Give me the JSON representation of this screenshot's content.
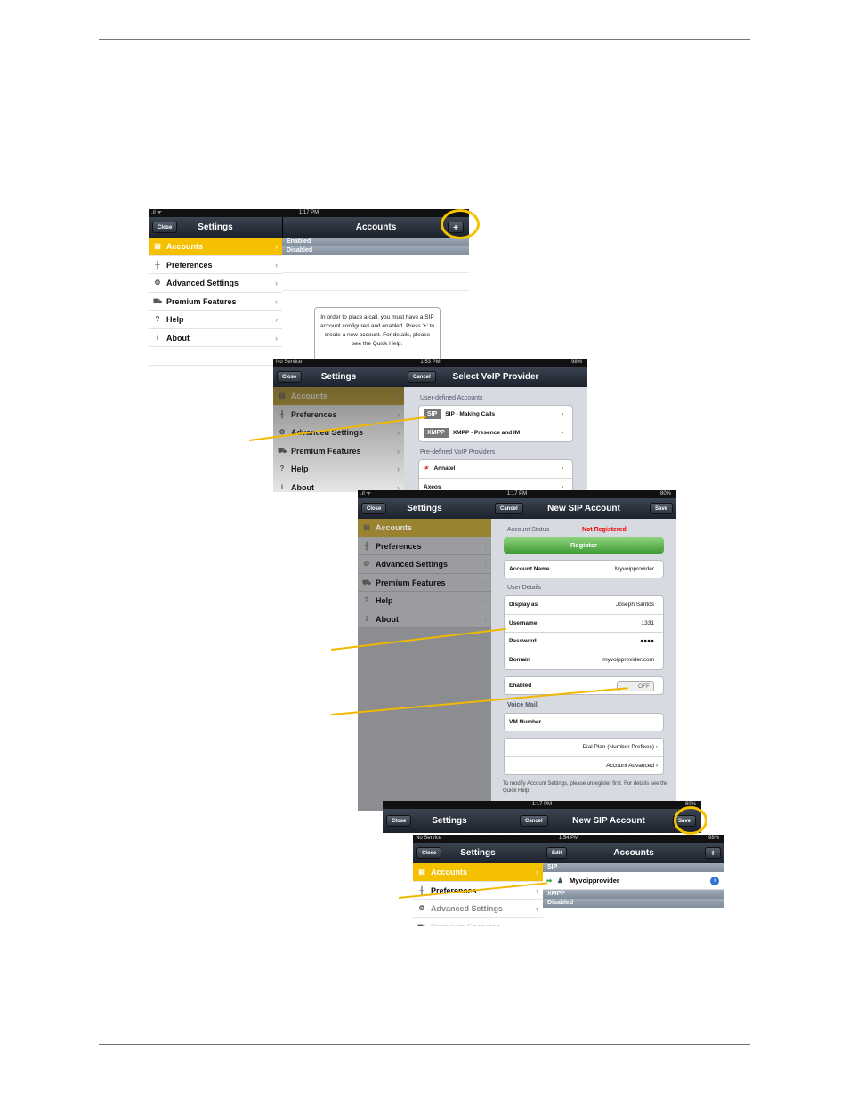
{
  "s1": {
    "time": "1:17 PM",
    "left_title": "Settings",
    "close": "Close",
    "right_title": "Accounts",
    "plus": "+",
    "menu": [
      {
        "label": "Accounts",
        "icon": "accounts-icon"
      },
      {
        "label": "Preferences",
        "icon": "preferences-icon"
      },
      {
        "label": "Advanced Settings",
        "icon": "gears-icon"
      },
      {
        "label": "Premium Features",
        "icon": "cart-icon"
      },
      {
        "label": "Help",
        "icon": "help-icon"
      },
      {
        "label": "About",
        "icon": "info-icon"
      }
    ],
    "enabled": "Enabled",
    "disabled": "Disabled",
    "hint": "In order to place a call, you must have a SIP account configured and enabled. Press '+' to create a new account. For details, please see the Quick Help."
  },
  "s2": {
    "carrier": "No Service",
    "time": "1:53 PM",
    "battery": "98%",
    "cancel": "Cancel",
    "title": "Select VoIP Provider",
    "left_title": "Settings",
    "close": "Close",
    "user_defined": "User-defined Accounts",
    "sip_badge": "SIP",
    "sip_label": "SIP - Making Calls",
    "xmpp_badge": "XMPP",
    "xmpp_label": "XMPP - Presence and IM",
    "predefined": "Pre-defined VoIP Providers",
    "provider1": "Annatel",
    "provider2": "Axeos"
  },
  "s3": {
    "time": "1:17 PM",
    "battery": "80%",
    "left_title": "Settings",
    "close": "Close",
    "cancel": "Cancel",
    "title": "New SIP Account",
    "save": "Save",
    "account_status_label": "Account Status",
    "account_status": "Not Registered",
    "register": "Register",
    "account_name_label": "Account Name",
    "account_name": "Myvoipprovider",
    "user_details": "User Details",
    "display_label": "Display as",
    "display": "Joseph Santos",
    "username_label": "Username",
    "username": "1331",
    "password_label": "Password",
    "password": "●●●●",
    "domain_label": "Domain",
    "domain": "myvoipprovider.com",
    "enabled_label": "Enabled",
    "toggle": "OFF",
    "voicemail": "Voice Mail",
    "vm_label": "VM Number",
    "dial_plan": "Dial Plan (Number Prefixes)",
    "account_advanced": "Account Advanced",
    "footer": "To modify Account Settings, please unregister first. For details see the Quick Help."
  },
  "s4": {
    "time": "1:17 PM",
    "battery": "80%",
    "close": "Close",
    "left_title": "Settings",
    "cancel": "Cancel",
    "title": "New SIP Account",
    "save": "Save"
  },
  "s5": {
    "carrier": "No Service",
    "time": "1:54 PM",
    "battery": "98%",
    "close": "Close",
    "left_title": "Settings",
    "edit": "Edit",
    "title": "Accounts",
    "plus": "+",
    "sip": "SIP",
    "account": "Myvoipprovider",
    "xmpp": "XMPP",
    "disabled": "Disabled"
  }
}
